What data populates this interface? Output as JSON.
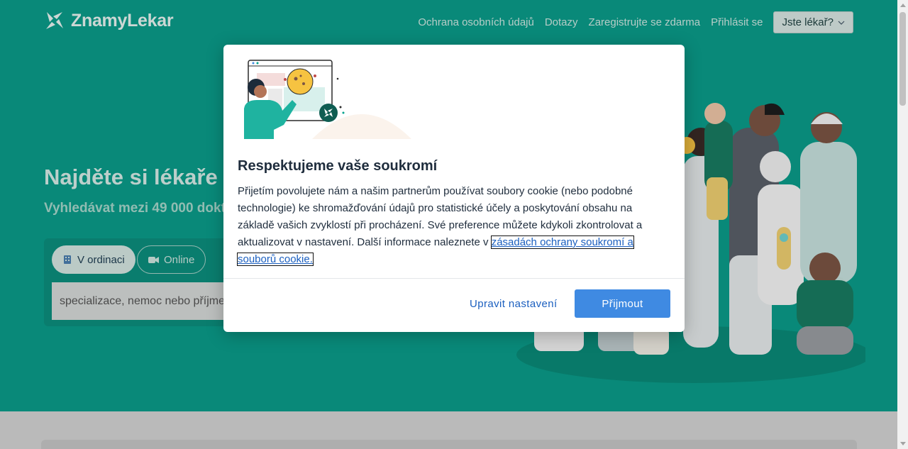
{
  "header": {
    "logo_text": "ZnamyLekar",
    "nav": [
      "Ochrana osobních údajů",
      "Dotazy",
      "Zaregistrujte se zdarma",
      "Přihlásit se"
    ],
    "doctor_button_label": "Jste lékař?"
  },
  "hero": {
    "title": "Najděte si lékaře a",
    "subtitle": "Vyhledávat mezi 49 000 dokt",
    "mode_office_label": "V ordinaci",
    "mode_online_label": "Online",
    "search_placeholder": "specializace, nemoc nebo příjme"
  },
  "modal": {
    "title": "Respektujeme vaše soukromí",
    "body_text": "Přijetím povolujete nám a našim partnerům používat soubory cookie (nebo podobné technologie) ke shromažďování údajů pro statistické účely a poskytování obsahu na základě vašich zvyklostí při procházení. Své preference můžete kdykoli zkontrolovat a aktualizovat v nastavení. Další informace naleznete v ",
    "policy_link": "zásadách ochrany soukromí a souborů cookie.",
    "settings_label": "Upravit nastavení",
    "accept_label": "Přijmout"
  },
  "colors": {
    "brand_teal": "#00a28d",
    "accept_blue": "#3f8ae2",
    "link_blue": "#1b5fbf"
  }
}
